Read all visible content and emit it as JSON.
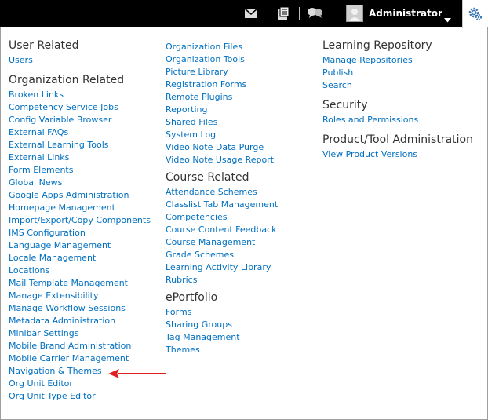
{
  "topbar": {
    "icons": [
      "mail-icon",
      "document-icon",
      "chat-bubbles-icon",
      "gear-icon"
    ],
    "user_name": "Administrator"
  },
  "columns": [
    {
      "groups": [
        {
          "title": "User Related",
          "links": [
            "Users"
          ]
        },
        {
          "title": "Organization Related",
          "links": [
            "Broken Links",
            "Competency Service Jobs",
            "Config Variable Browser",
            "External FAQs",
            "External Learning Tools",
            "External Links",
            "Form Elements",
            "Global News",
            "Google Apps Administration",
            "Homepage Management",
            "Import/Export/Copy Components",
            "IMS Configuration",
            "Language Management",
            "Locale Management",
            "Locations",
            "Mail Template Management",
            "Manage Extensibility",
            "Manage Workflow Sessions",
            "Metadata Administration",
            "Minibar Settings",
            "Mobile Brand Administration",
            "Mobile Carrier Management",
            "Navigation & Themes",
            "Org Unit Editor",
            "Org Unit Type Editor"
          ]
        }
      ]
    },
    {
      "groups": [
        {
          "title": "",
          "links": [
            "Organization Files",
            "Organization Tools",
            "Picture Library",
            "Registration Forms",
            "Remote Plugins",
            "Reporting",
            "Shared Files",
            "System Log",
            "Video Note Data Purge",
            "Video Note Usage Report"
          ]
        },
        {
          "title": "Course Related",
          "links": [
            "Attendance Schemes",
            "Classlist Tab Management",
            "Competencies",
            "Course Content Feedback",
            "Course Management",
            "Grade Schemes",
            "Learning Activity Library",
            "Rubrics"
          ]
        },
        {
          "title": "ePortfolio",
          "links": [
            "Forms",
            "Sharing Groups",
            "Tag Management",
            "Themes"
          ]
        }
      ]
    },
    {
      "groups": [
        {
          "title": "Learning Repository",
          "links": [
            "Manage Repositories",
            "Publish",
            "Search"
          ]
        },
        {
          "title": "Security",
          "links": [
            "Roles and Permissions"
          ]
        },
        {
          "title": "Product/Tool Administration",
          "links": [
            "View Product Versions"
          ]
        }
      ]
    }
  ],
  "annotation": {
    "arrow_color": "#e02020"
  },
  "colors": {
    "link": "#006fbf",
    "heading": "#333333",
    "topbar": "#000000"
  }
}
